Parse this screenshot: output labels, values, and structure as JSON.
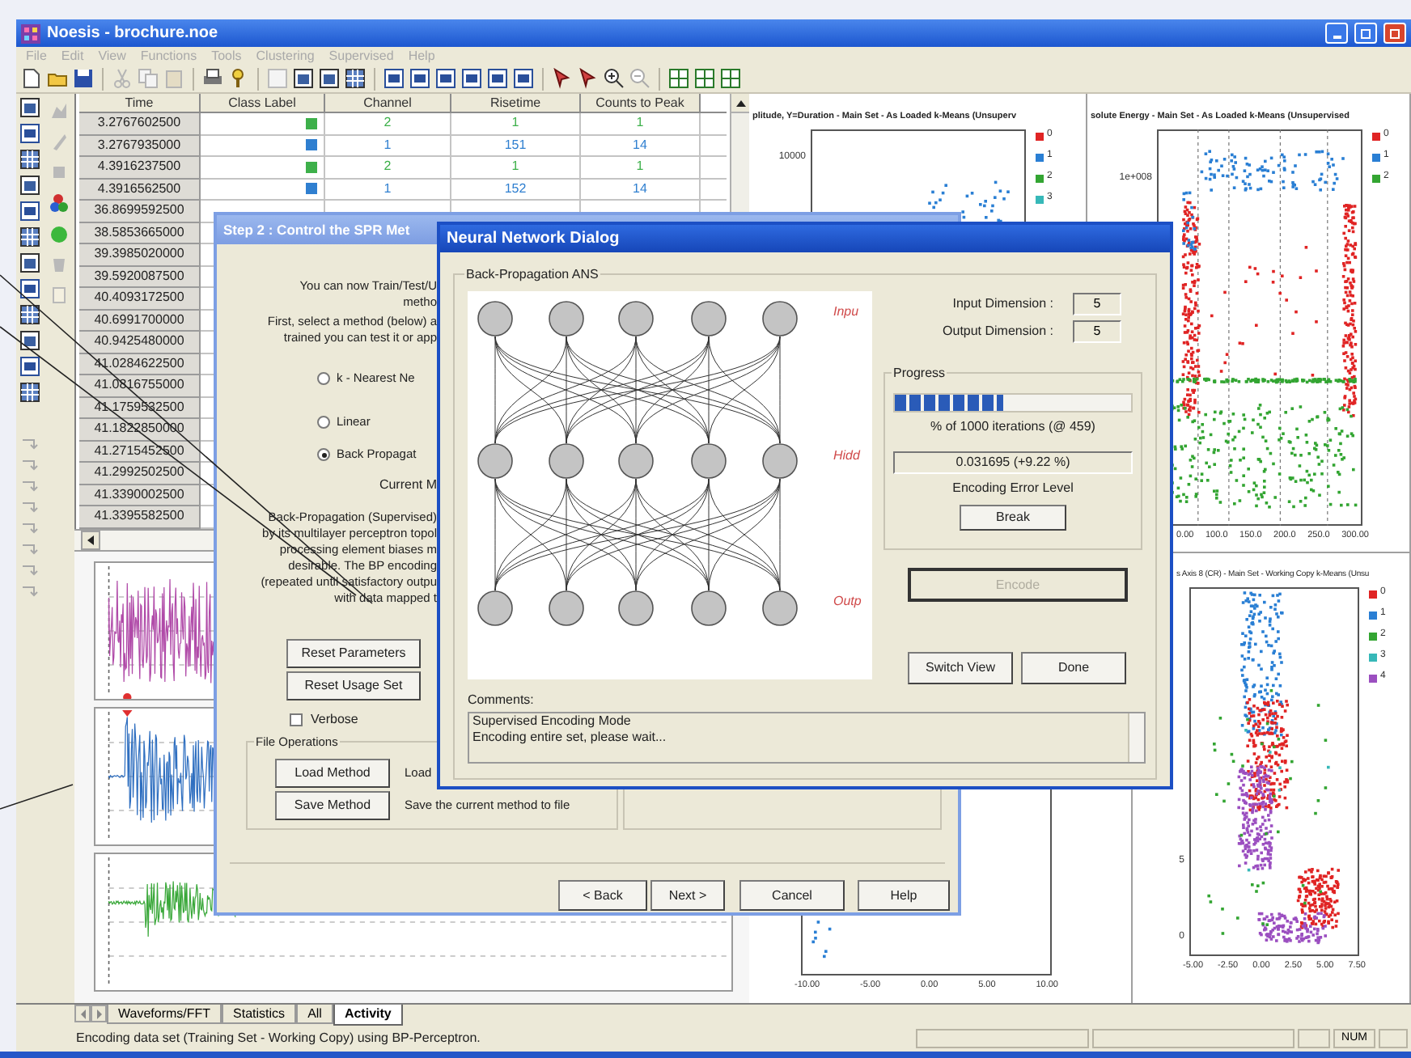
{
  "window": {
    "title": "Noesis - brochure.noe"
  },
  "menu": [
    "File",
    "Edit",
    "View",
    "Functions",
    "Tools",
    "Clustering",
    "Supervised",
    "Help"
  ],
  "table": {
    "columns": [
      "Time",
      "Class Label",
      "Channel",
      "Risetime",
      "Counts to Peak"
    ],
    "rows": [
      {
        "time": "3.2767602500",
        "color": "#3db04a",
        "channel": "2",
        "risetime": "1",
        "counts_to_peak": "1"
      },
      {
        "time": "3.2767935000",
        "color": "#2f7fd0",
        "channel": "1",
        "risetime": "151",
        "counts_to_peak": "14"
      },
      {
        "time": "4.3916237500",
        "color": "#3db04a",
        "channel": "2",
        "risetime": "1",
        "counts_to_peak": "1"
      },
      {
        "time": "4.3916562500",
        "color": "#2f7fd0",
        "channel": "1",
        "risetime": "152",
        "counts_to_peak": "14"
      },
      {
        "time": "36.8699592500"
      },
      {
        "time": "38.5853665000"
      },
      {
        "time": "39.3985020000"
      },
      {
        "time": "39.5920087500"
      },
      {
        "time": "40.4093172500"
      },
      {
        "time": "40.6991700000"
      },
      {
        "time": "40.9425480000"
      },
      {
        "time": "41.0284622500"
      },
      {
        "time": "41.0816755000"
      },
      {
        "time": "41.1759532500"
      },
      {
        "time": "41.1822850000"
      },
      {
        "time": "41.2715452500"
      },
      {
        "time": "41.2992502500"
      },
      {
        "time": "41.3390002500"
      },
      {
        "time": "41.3395582500"
      }
    ]
  },
  "plots": [
    {
      "title": "plitude, Y=Duration - Main Set - As Loaded k-Means (Unsuperv",
      "y_ticks": [
        "10000"
      ],
      "legend": [
        {
          "label": "0",
          "color": "#e02424"
        },
        {
          "label": "1",
          "color": "#2a7fd4"
        },
        {
          "label": "2",
          "color": "#33a532"
        },
        {
          "label": "3",
          "color": "#37b8b8"
        }
      ]
    },
    {
      "title": "solute Energy - Main Set - As Loaded k-Means (Unsupervised",
      "y_ticks": [
        "1e+008"
      ],
      "x_ticks": [
        "0.00",
        "100.0",
        "150.0",
        "200.0",
        "250.0",
        "300.00"
      ],
      "legend": [
        {
          "label": "0",
          "color": "#e02424"
        },
        {
          "label": "1",
          "color": "#2a7fd4"
        },
        {
          "label": "2",
          "color": "#33a532"
        }
      ]
    },
    {
      "x_ticks": [
        "-10.00",
        "-5.00",
        "0.00",
        "5.00",
        "10.00"
      ]
    },
    {
      "title": "s Axis 8 (CR) - Main Set - Working Copy k-Means (Unsu",
      "y_ticks": [
        "5",
        "0"
      ],
      "x_ticks": [
        "-5.00",
        "-2.50",
        "0.00",
        "2.50",
        "5.00",
        "7.50"
      ],
      "legend": [
        {
          "label": "0",
          "color": "#e02424"
        },
        {
          "label": "1",
          "color": "#2a7fd4"
        },
        {
          "label": "2",
          "color": "#33a532"
        },
        {
          "label": "3",
          "color": "#37b8b8"
        },
        {
          "label": "4",
          "color": "#9b4fc0"
        }
      ]
    }
  ],
  "tabs": [
    {
      "label": "Waveforms/FFT",
      "selected": false
    },
    {
      "label": "Statistics",
      "selected": false
    },
    {
      "label": "All",
      "selected": false
    },
    {
      "label": "Activity",
      "selected": true
    }
  ],
  "status_bar": {
    "message": "Encoding data set (Training Set - Working Copy) using BP-Perceptron.",
    "indicator": "NUM"
  },
  "step2_dialog": {
    "title": "Step 2 : Control the SPR Met",
    "intro": [
      "You can now Train/Test/U",
      "metho"
    ],
    "instructions": [
      "First, select a method (below) a",
      "trained you can test it or app"
    ],
    "methods": [
      {
        "label": "k - Nearest Ne",
        "selected": false
      },
      {
        "label": "Linear",
        "selected": false
      },
      {
        "label": "Back Propagat",
        "selected": true
      }
    ],
    "current_label": "Current M",
    "description": [
      "Back-Propagation (Supervised)",
      "by its multilayer perceptron topol",
      "processing element biases m",
      "desirable. The BP encoding",
      "(repeated until satisfactory outpu",
      "with data mapped t"
    ],
    "buttons": [
      "Reset Parameters",
      "Reset Usage Set"
    ],
    "verbose": {
      "label": "Verbose",
      "checked": false
    },
    "file_operations": {
      "title": "File Operations",
      "rows": [
        {
          "button": "Load Method",
          "text": "Load"
        },
        {
          "button": "Save Method",
          "text": "Save the current method to file"
        }
      ]
    },
    "nav_buttons": [
      "< Back",
      "Next >",
      "Cancel",
      "Help"
    ]
  },
  "nn_dialog": {
    "title": "Neural Network Dialog",
    "group": "Back-Propagation ANS",
    "layer_labels": [
      "Inpu",
      "Hidd",
      "Outp"
    ],
    "fields": [
      {
        "label": "Input Dimension :",
        "value": "5"
      },
      {
        "label": "Output Dimension :",
        "value": "5"
      }
    ],
    "progress": {
      "title": "Progress",
      "level": 0.46,
      "caption": "% of 1000 iterations (@ 459)"
    },
    "error": {
      "value": "0.031695 (+9.22 %)",
      "caption": "Encoding Error Level"
    },
    "break_button": "Break",
    "encode_button": {
      "label": "Encode",
      "disabled": true
    },
    "buttons": [
      "Switch View",
      "Done"
    ],
    "comments": {
      "label": "Comments:",
      "lines": [
        "Supervised Encoding Mode",
        "Encoding entire set, please wait..."
      ]
    }
  }
}
